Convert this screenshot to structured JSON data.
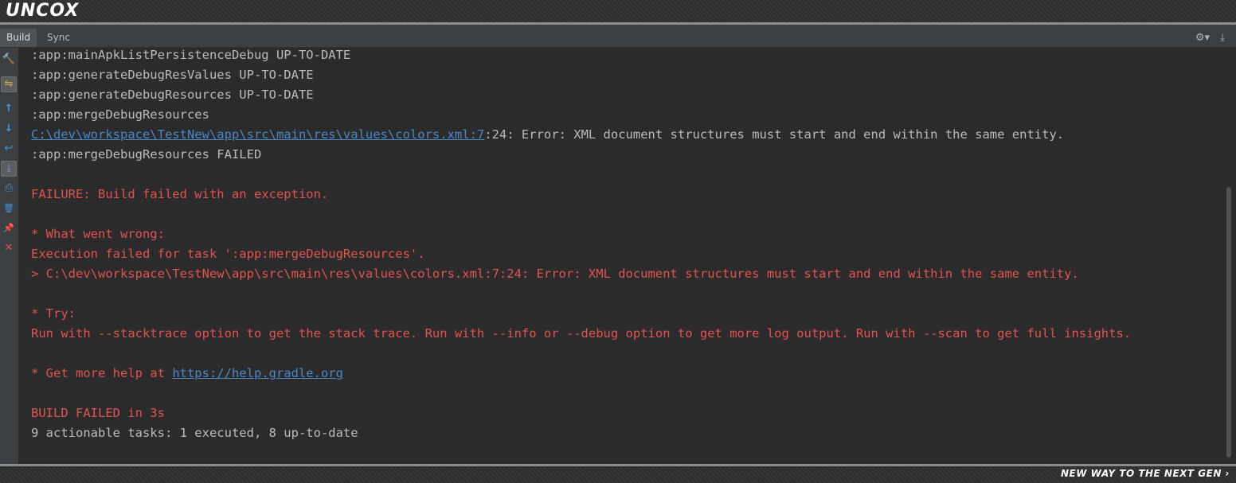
{
  "banner": {
    "brand": "UNCOX",
    "slogan": "NEW WAY TO THE NEXT GEN ›"
  },
  "tabs": [
    {
      "label": "Build",
      "active": true
    },
    {
      "label": "Sync",
      "active": false
    }
  ],
  "header_icons": {
    "settings": "gear-icon",
    "settings_glyph": "⚙▾",
    "hide": "hide-icon",
    "hide_glyph": "⤓"
  },
  "toolbar": [
    {
      "name": "build-hammer-icon",
      "glyph": "🔨",
      "color": "#4fa84f"
    },
    {
      "name": "toggle-view-icon",
      "glyph": "⇋",
      "color": "#d8b24a"
    },
    {
      "name": "previous-occurrence-icon",
      "glyph": "↑",
      "color": "#4a90d9"
    },
    {
      "name": "next-occurrence-icon",
      "glyph": "↓",
      "color": "#4a90d9"
    },
    {
      "name": "soft-wrap-icon",
      "glyph": "↩",
      "color": "#4a90d9"
    },
    {
      "name": "scroll-to-end-icon",
      "glyph": "⤓",
      "color": "#b07fd8"
    },
    {
      "name": "print-icon",
      "glyph": "⎙",
      "color": "#4a90d9"
    },
    {
      "name": "clear-all-icon",
      "glyph": "🗑",
      "color": "#4a90d9"
    },
    {
      "name": "pin-icon",
      "glyph": "📌",
      "color": "#b07fd8"
    },
    {
      "name": "close-icon",
      "glyph": "✕",
      "color": "#e05353"
    }
  ],
  "console": {
    "l1": ":app:mainApkListPersistenceDebug UP-TO-DATE",
    "l2": ":app:generateDebugResValues UP-TO-DATE",
    "l3": ":app:generateDebugResources UP-TO-DATE",
    "l4": ":app:mergeDebugResources",
    "l5_link": "C:\\dev\\workspace\\TestNew\\app\\src\\main\\res\\values\\colors.xml:7",
    "l5_rest": ":24: Error: XML document structures must start and end within the same entity.",
    "l6": ":app:mergeDebugResources FAILED",
    "l7": "FAILURE: Build failed with an exception.",
    "l8": "* What went wrong:",
    "l9": "Execution failed for task ':app:mergeDebugResources'.",
    "l10": "> C:\\dev\\workspace\\TestNew\\app\\src\\main\\res\\values\\colors.xml:7:24: Error: XML document structures must start and end within the same entity.",
    "l11": "* Try:",
    "l12": "Run with --stacktrace option to get the stack trace. Run with --info or --debug option to get more log output. Run with --scan to get full insights.",
    "l13_prefix": "* Get more help at ",
    "l13_link": "https://help.gradle.org",
    "l14": "BUILD FAILED in 3s",
    "l15": "9 actionable tasks: 1 executed, 8 up-to-date"
  }
}
